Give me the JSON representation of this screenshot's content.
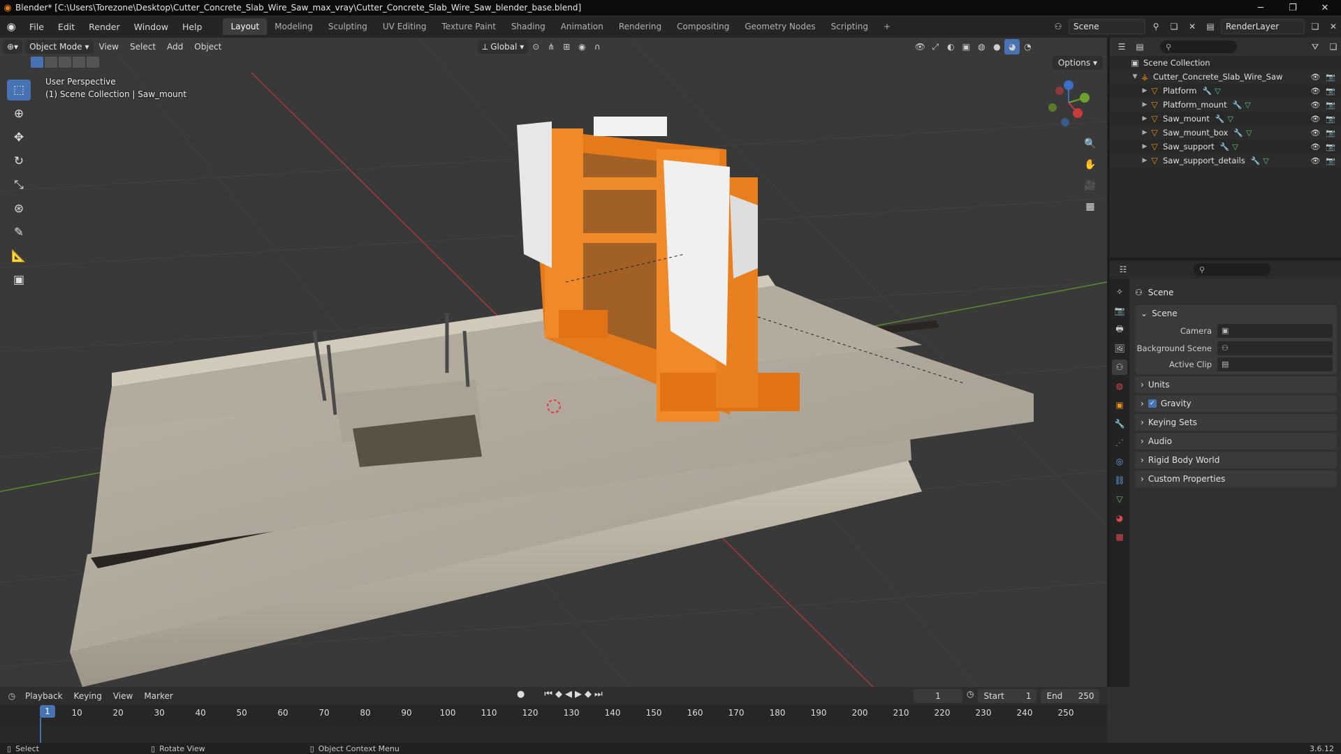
{
  "window": {
    "title": "Blender* [C:\\Users\\Torezone\\Desktop\\Cutter_Concrete_Slab_Wire_Saw_max_vray\\Cutter_Concrete_Slab_Wire_Saw_blender_base.blend]"
  },
  "menu": [
    "File",
    "Edit",
    "Render",
    "Window",
    "Help"
  ],
  "workspaces": [
    "Layout",
    "Modeling",
    "Sculpting",
    "UV Editing",
    "Texture Paint",
    "Shading",
    "Animation",
    "Rendering",
    "Compositing",
    "Geometry Nodes",
    "Scripting"
  ],
  "active_workspace": "Layout",
  "scene_field": "Scene",
  "render_layer_field": "RenderLayer",
  "viewport": {
    "mode": "Object Mode",
    "menus": [
      "View",
      "Select",
      "Add",
      "Object"
    ],
    "transform_orientation": "Global",
    "options_label": "Options",
    "info_line1": "User Perspective",
    "info_line2": "(1) Scene Collection | Saw_mount"
  },
  "outliner": {
    "root": "Scene Collection",
    "collection": "Cutter_Concrete_Slab_Wire_Saw",
    "objects": [
      {
        "name": "Platform"
      },
      {
        "name": "Platform_mount"
      },
      {
        "name": "Saw_mount"
      },
      {
        "name": "Saw_mount_box"
      },
      {
        "name": "Saw_support"
      },
      {
        "name": "Saw_support_details"
      }
    ]
  },
  "properties": {
    "title": "Scene",
    "panel": "Scene",
    "fields": [
      {
        "label": "Camera",
        "value": ""
      },
      {
        "label": "Background Scene",
        "value": ""
      },
      {
        "label": "Active Clip",
        "value": ""
      }
    ],
    "collapsed_panels": [
      "Units",
      "Gravity",
      "Keying Sets",
      "Audio",
      "Rigid Body World",
      "Custom Properties"
    ],
    "gravity_checked": true
  },
  "timeline": {
    "menus": [
      "Playback",
      "Keying",
      "View",
      "Marker"
    ],
    "current_frame": "1",
    "start_label": "Start",
    "start": "1",
    "end_label": "End",
    "end": "250",
    "ticks": [
      "1",
      "10",
      "20",
      "30",
      "40",
      "50",
      "60",
      "70",
      "80",
      "90",
      "100",
      "110",
      "120",
      "130",
      "140",
      "150",
      "160",
      "170",
      "180",
      "190",
      "200",
      "210",
      "220",
      "230",
      "240",
      "250"
    ]
  },
  "statusbar": {
    "select": "Select",
    "rotate": "Rotate View",
    "context": "Object Context Menu",
    "version": "3.6.12"
  },
  "colors": {
    "accent": "#4772b3",
    "orange_object": "#e8911a",
    "machine_orange": "#f07d1e"
  }
}
